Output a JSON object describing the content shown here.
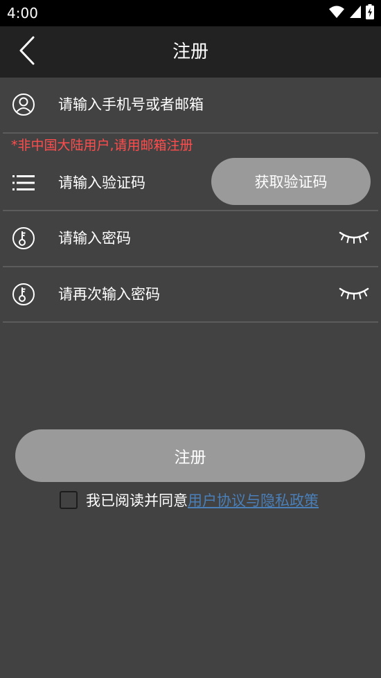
{
  "status_bar": {
    "time": "4:00",
    "icons": [
      "wifi-icon",
      "cell-signal-icon",
      "battery-charging-icon"
    ]
  },
  "app_bar": {
    "title": "注册",
    "back_icon": "chevron-left-icon"
  },
  "form": {
    "account": {
      "placeholder": "请输入手机号或者邮箱",
      "icon": "user-circle-icon"
    },
    "notice": "*非中国大陆用户,请用邮箱注册",
    "verification": {
      "placeholder": "请输入验证码",
      "icon": "menu-lines-icon",
      "button_label": "获取验证码"
    },
    "password": {
      "placeholder": "请输入密码",
      "icon": "key-circle-icon",
      "toggle_icon": "eye-closed-icon"
    },
    "confirm_password": {
      "placeholder": "请再次输入密码",
      "icon": "key-circle-icon",
      "toggle_icon": "eye-closed-icon"
    }
  },
  "register_button": "注册",
  "agreement": {
    "checked": false,
    "text": "我已阅读并同意",
    "link": "用户协议与隐私政策"
  },
  "colors": {
    "background": "#424242",
    "app_bar": "#222222",
    "status_bar": "#000000",
    "button": "#9a9a9a",
    "notice": "#ff4d4d",
    "link": "#4a7fb8",
    "divider": "#5c5c5c"
  }
}
